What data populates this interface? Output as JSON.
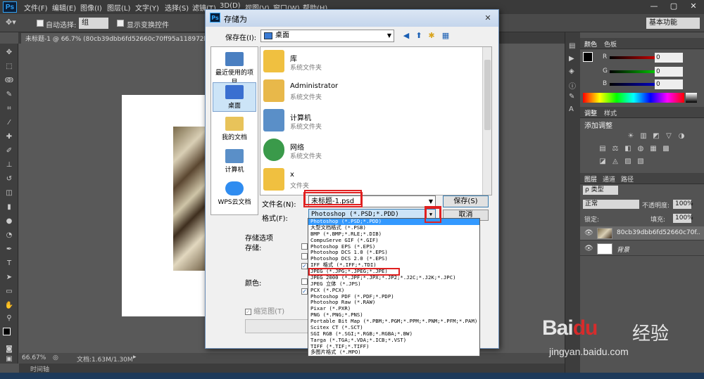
{
  "menubar": {
    "logo": "Ps",
    "items": [
      "文件(F)",
      "编辑(E)",
      "图像(I)",
      "图层(L)",
      "文字(Y)",
      "选择(S)",
      "滤镜(T)",
      "3D(D)",
      "视图(V)",
      "窗口(W)",
      "帮助(H)"
    ],
    "win_controls": [
      "—",
      "▢",
      "✕"
    ]
  },
  "options": {
    "auto_select_label": "自动选择:",
    "auto_select_value": "组",
    "show_transform": "显示变换控件",
    "workspace": "基本功能"
  },
  "document_tab": "未标题-1 @ 66.7% (80cb39dbb6fd52660c70ff95a118972bd507",
  "status": {
    "zoom": "66.67%",
    "doc_size": "文档:1.63M/1.30M",
    "timeline": "时间轴"
  },
  "color_panel": {
    "tabs": [
      "颜色",
      "色板"
    ],
    "channels": [
      {
        "label": "R",
        "value": "0",
        "color": "#e02020"
      },
      {
        "label": "G",
        "value": "0",
        "color": "#20c020"
      },
      {
        "label": "B",
        "value": "0",
        "color": "#2040e0"
      }
    ]
  },
  "adjust_panel": {
    "tabs": [
      "调整",
      "样式"
    ],
    "title": "添加调整",
    "icons_row1": [
      "☀",
      "▥",
      "◩",
      "▽",
      "◑"
    ],
    "icons_row2": [
      "▤",
      "⚖",
      "◧",
      "◍",
      "▦",
      "▩"
    ],
    "icons_row3": [
      "◪",
      "◬",
      "▨",
      "▧"
    ]
  },
  "layers_panel": {
    "tabs": [
      "图层",
      "通道",
      "路径"
    ],
    "filter_label": "ρ 类型",
    "blend_mode": "正常",
    "opacity_label": "不透明度:",
    "opacity_value": "100%",
    "lock_label": "锁定:",
    "fill_label": "填充:",
    "fill_value": "100%",
    "layers": [
      {
        "name": "80cb39dbb6fd52660c70f...",
        "kind": "photo"
      },
      {
        "name": "背景",
        "kind": "white"
      }
    ]
  },
  "dialog": {
    "logo": "Ps",
    "title": "存储为",
    "close": "✕",
    "save_in_label": "保存在(I):",
    "save_in_value": "桌面",
    "places": [
      {
        "label": "最近使用的项目",
        "color": "#4a7fc1"
      },
      {
        "label": "桌面",
        "color": "#3a6fd0"
      },
      {
        "label": "我的文档",
        "color": "#e8c35a"
      },
      {
        "label": "计算机",
        "color": "#5a8fc8"
      },
      {
        "label": "WPS云文档",
        "color": "#2f8cf0"
      }
    ],
    "files": [
      {
        "name": "库",
        "sub": "系统文件夹",
        "color": "#f0c040"
      },
      {
        "name": "Administrator",
        "sub": "系统文件夹",
        "color": "#e8b84a"
      },
      {
        "name": "计算机",
        "sub": "系统文件夹",
        "color": "#5a8fc8"
      },
      {
        "name": "网络",
        "sub": "系统文件夹",
        "color": "#3a9a4a"
      },
      {
        "name": "x",
        "sub": "文件夹",
        "color": "#f0c040"
      }
    ],
    "filename_label": "文件名(N):",
    "filename_value": "未标题-1.psd",
    "format_label": "格式(F):",
    "format_value": "Photoshop (*.PSD;*.PDD)",
    "save_button": "保存(S)",
    "cancel_button": "取消",
    "options_title": "存储选项",
    "options_save_label": "存储:",
    "options_color_label": "颜色:",
    "thumbnail_label": "缩览图(T)"
  },
  "format_list": [
    "Photoshop (*.PSD;*.PDD)",
    "大型文档格式 (*.PSB)",
    "BMP (*.BMP;*.RLE;*.DIB)",
    "CompuServe GIF (*.GIF)",
    "Photoshop EPS (*.EPS)",
    "Photoshop DCS 1.0 (*.EPS)",
    "Photoshop DCS 2.0 (*.EPS)",
    "IFF 格式 (*.IFF;*.TDI)",
    "JPEG (*.JPG;*.JPEG;*.JPE)",
    "JPEG 2000 (*.JPF;*.JPX;*.JP2;*.J2C;*.J2K;*.JPC)",
    "JPEG 立体 (*.JPS)",
    "PCX (*.PCX)",
    "Photoshop PDF (*.PDF;*.PDP)",
    "Photoshop Raw (*.RAW)",
    "Pixar (*.PXR)",
    "PNG (*.PNG;*.PNS)",
    "Portable Bit Map (*.PBM;*.PGM;*.PPM;*.PNM;*.PFM;*.PAM)",
    "Scitex CT (*.SCT)",
    "SGI RGB (*.SGI;*.RGB;*.RGBA;*.BW)",
    "Targa (*.TGA;*.VDA;*.ICB;*.VST)",
    "TIFF (*.TIF;*.TIFF)",
    "多图片格式 (*.MPO)"
  ],
  "watermark": {
    "logo": "Bai",
    "paw": "du",
    "jingyan": "经验",
    "url": "jingyan.baidu.com"
  }
}
